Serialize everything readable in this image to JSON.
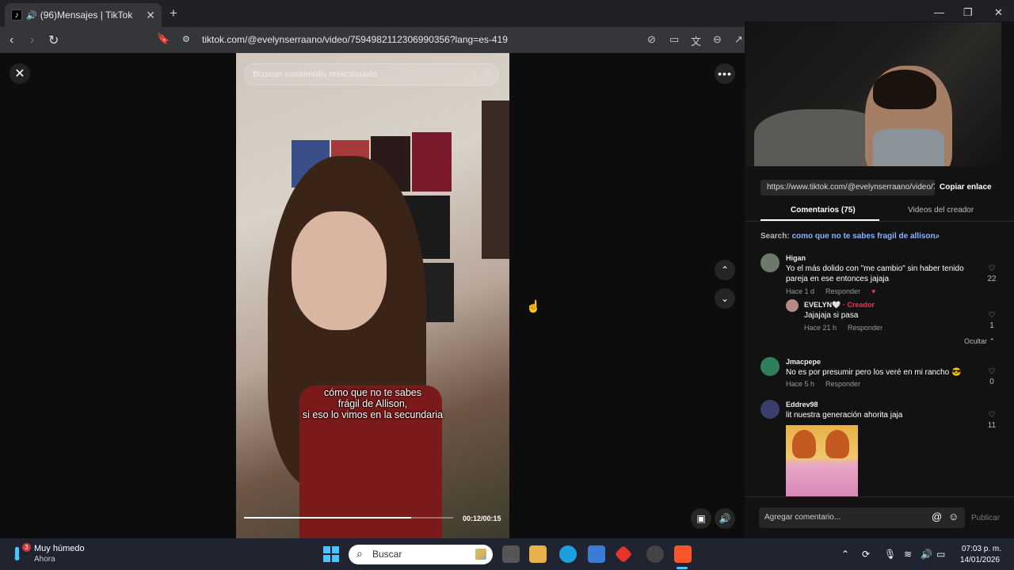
{
  "browser": {
    "tab_title": "(96)Mensajes | TikTok",
    "tab_close": "✕",
    "new_tab": "+",
    "url": "tiktok.com/@evelynserraano/video/7594982112306990356?lang=es-419"
  },
  "video": {
    "search_placeholder": "Buscar contenido relacionado",
    "caption_lines": [
      "cómo que no te sabes",
      "frágil de Allison,",
      "si eso lo vimos en la secundaria"
    ],
    "timecode": "00:12/00:15",
    "progress": 0.8
  },
  "panel": {
    "share_link": "https://www.tiktok.com/@evelynserraano/video/75...",
    "copy_link_label": "Copiar enlace",
    "tab_comments": "Comentarios (75)",
    "tab_creator": "Videos del creador",
    "search_prefix": "Search: ",
    "search_query": "como que no te sabes fragil de allison",
    "comments": [
      {
        "user": "Higan",
        "text": "Yo el más dolido con \"me cambio\" sin haber tenido pareja en ese entonces jajaja",
        "time": "Hace 1 d",
        "reply": "Responder",
        "likes": "22"
      },
      {
        "user": "EVELYN🤍",
        "creator_tag": "· Creador",
        "text": "Jajajaja si pasa",
        "time": "Hace 21 h",
        "reply": "Responder",
        "likes": "1"
      },
      {
        "user": "Jmacpepe",
        "text": "No es por presumir pero los veré en mi rancho 😎",
        "time": "Hace 5 h",
        "reply": "Responder",
        "likes": "0"
      },
      {
        "user": "Eddrev98",
        "text": "lit nuestra generación ahorita jaja",
        "likes": "11"
      }
    ],
    "hide_label": "Ocultar ⌃",
    "comment_placeholder": "Agregar comentario...",
    "publish_label": "Publicar"
  },
  "taskbar": {
    "weather_badge": "3",
    "weather_title": "Muy húmedo",
    "weather_sub": "Ahora",
    "search_label": "Buscar",
    "time": "07:03 p. m.",
    "date": "14/01/2026"
  },
  "colors": {
    "accent": "#fe2c55",
    "link": "#8ab4f8",
    "windows_blue": "#4cc2ff"
  }
}
